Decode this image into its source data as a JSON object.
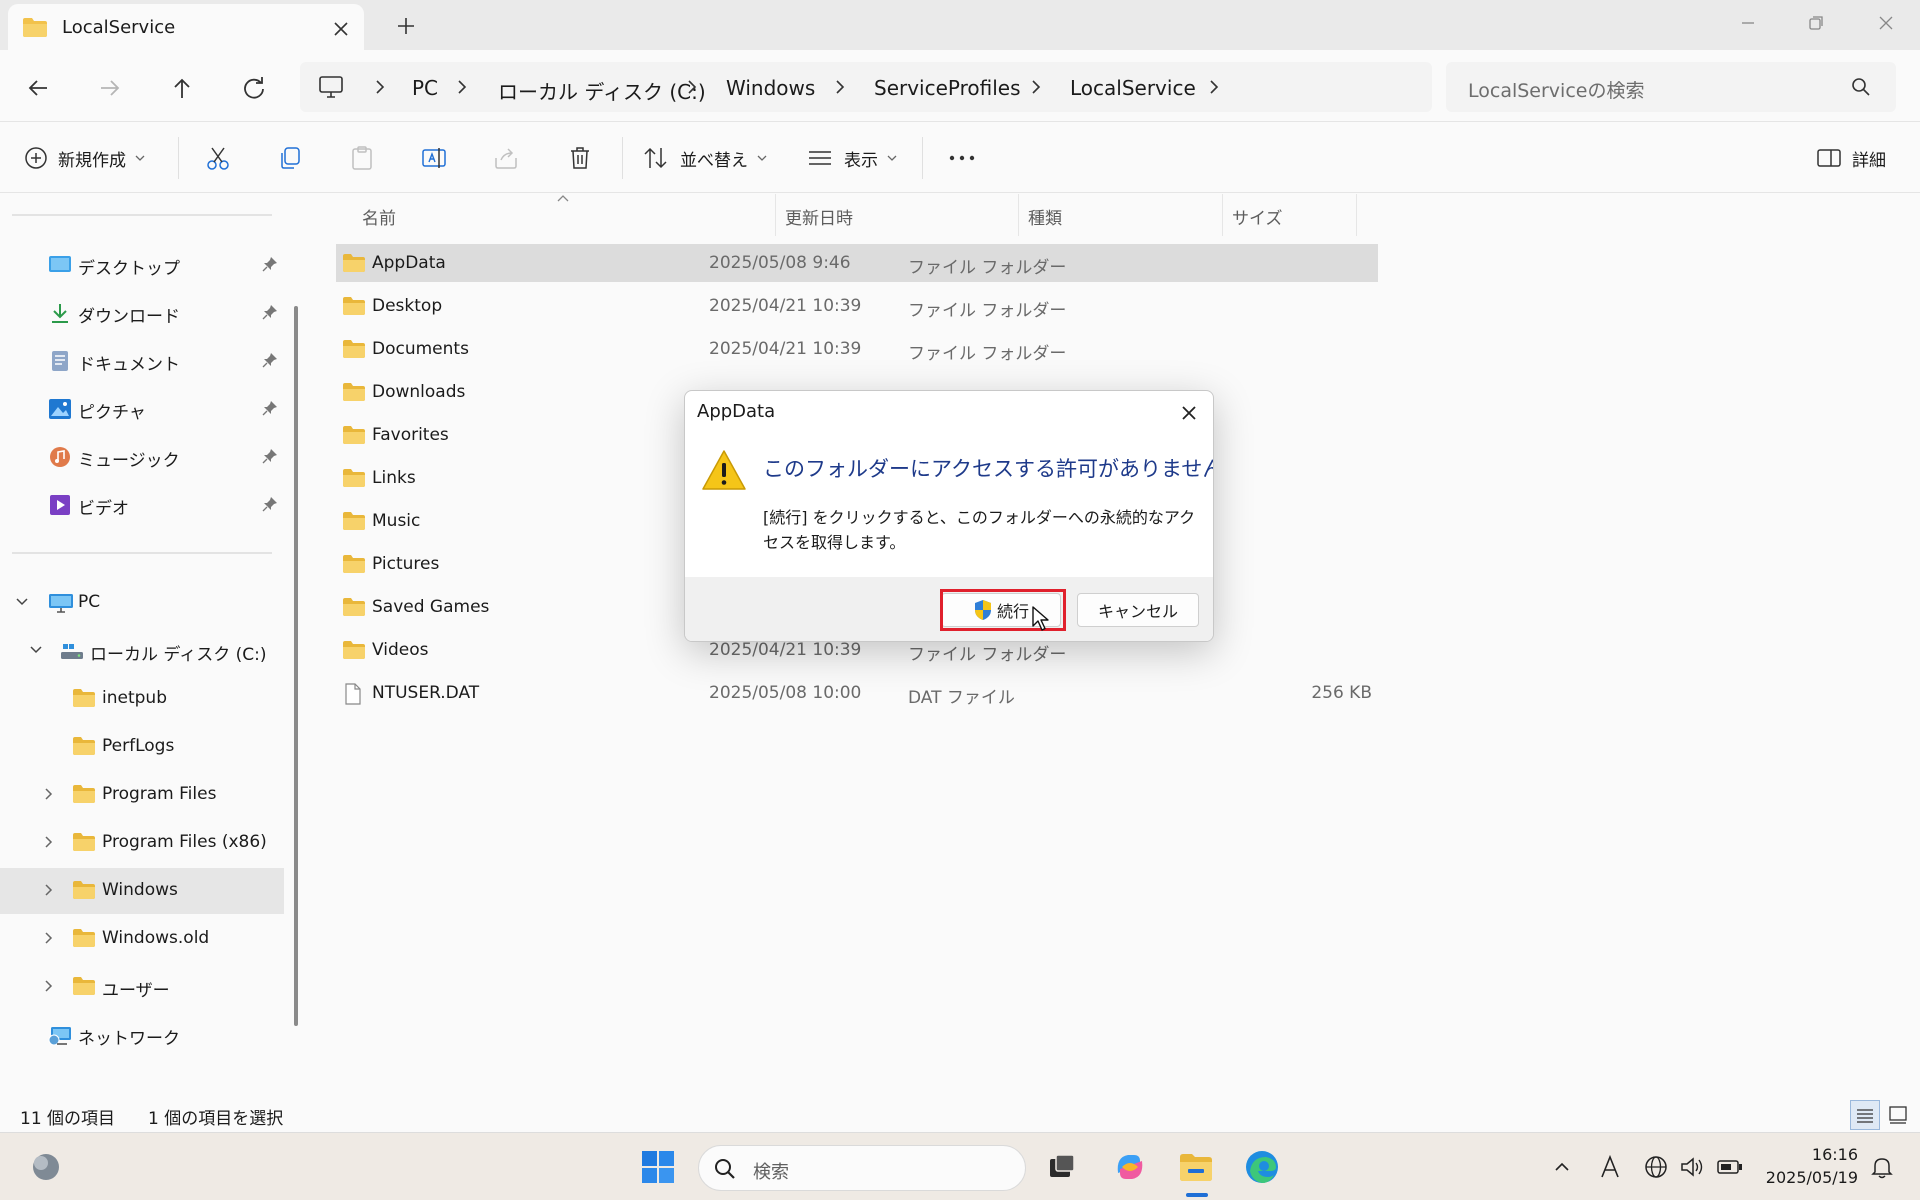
{
  "window": {
    "tab_title": "LocalService"
  },
  "address": {
    "breadcrumbs": [
      "PC",
      "ローカル ディスク (C:)",
      "Windows",
      "ServiceProfiles",
      "LocalService"
    ],
    "search_placeholder": "LocalServiceの検索"
  },
  "toolbar": {
    "new_label": "新規作成",
    "sort_label": "並べ替え",
    "view_label": "表示",
    "details_label": "詳細"
  },
  "sidebar": {
    "quick_access": [
      {
        "label": "デスクトップ",
        "icon": "desktop-icon"
      },
      {
        "label": "ダウンロード",
        "icon": "download-icon"
      },
      {
        "label": "ドキュメント",
        "icon": "documents-icon"
      },
      {
        "label": "ピクチャ",
        "icon": "pictures-icon"
      },
      {
        "label": "ミュージック",
        "icon": "music-icon"
      },
      {
        "label": "ビデオ",
        "icon": "videos-icon"
      }
    ],
    "tree": [
      {
        "label": "PC"
      },
      {
        "label": "ローカル ディスク (C:)"
      },
      {
        "label": "inetpub"
      },
      {
        "label": "PerfLogs"
      },
      {
        "label": "Program Files"
      },
      {
        "label": "Program Files (x86)"
      },
      {
        "label": "Windows"
      },
      {
        "label": "Windows.old"
      },
      {
        "label": "ユーザー"
      },
      {
        "label": "ネットワーク"
      }
    ]
  },
  "columns": {
    "name": "名前",
    "modified": "更新日時",
    "type": "種類",
    "size": "サイズ"
  },
  "files": [
    {
      "name": "AppData",
      "date": "2025/05/08 9:46",
      "type": "ファイル フォルダー",
      "size": ""
    },
    {
      "name": "Desktop",
      "date": "2025/04/21 10:39",
      "type": "ファイル フォルダー",
      "size": ""
    },
    {
      "name": "Documents",
      "date": "2025/04/21 10:39",
      "type": "ファイル フォルダー",
      "size": ""
    },
    {
      "name": "Downloads",
      "date": "",
      "type": "",
      "size": ""
    },
    {
      "name": "Favorites",
      "date": "",
      "type": "",
      "size": ""
    },
    {
      "name": "Links",
      "date": "",
      "type": "",
      "size": ""
    },
    {
      "name": "Music",
      "date": "",
      "type": "",
      "size": ""
    },
    {
      "name": "Pictures",
      "date": "",
      "type": "",
      "size": ""
    },
    {
      "name": "Saved Games",
      "date": "",
      "type": "",
      "size": ""
    },
    {
      "name": "Videos",
      "date": "2025/04/21 10:39",
      "type": "ファイル フォルダー",
      "size": ""
    },
    {
      "name": "NTUSER.DAT",
      "date": "2025/05/08 10:00",
      "type": "DAT ファイル",
      "size": "256 KB"
    }
  ],
  "status": {
    "item_count": "11 個の項目",
    "selected_count": "1 個の項目を選択"
  },
  "dialog": {
    "title": "AppData",
    "heading": "このフォルダーにアクセスする許可がありません。",
    "body": "[続行] をクリックすると、このフォルダーへの永続的なアクセスを取得します。",
    "continue_label": "続行",
    "cancel_label": "キャンセル"
  },
  "taskbar": {
    "search_placeholder": "検索",
    "time": "16:16",
    "date": "2025/05/19"
  },
  "colors": {
    "accent": "#1f6fd6",
    "dialog_heading": "#1e3a8a",
    "highlight": "#e0202c",
    "folder": "#f2c24b"
  }
}
